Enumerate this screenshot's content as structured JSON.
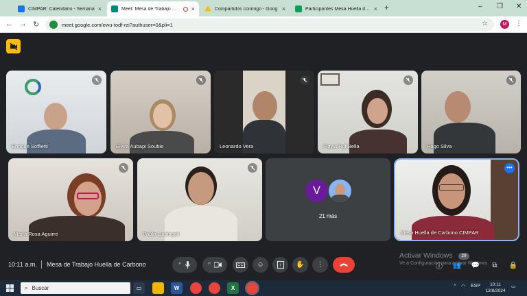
{
  "browser": {
    "tabs": [
      {
        "title": "CIMPAR: Calendario - Semana",
        "close": "×",
        "favicon_color": "#1a73e8",
        "active": false
      },
      {
        "title": "Meet: Mesa de Trabajo Hue",
        "close": "×",
        "favicon_color": "#00897b",
        "active": true
      },
      {
        "title": "Compartidos conmigo - Goog",
        "close": "×",
        "favicon_color": "#fbbc04",
        "active": false
      },
      {
        "title": "Participantes Mesa Huella de C",
        "close": "×",
        "favicon_color": "#0f9d58",
        "active": false
      }
    ],
    "new_tab": "+",
    "window_controls": {
      "minimize": "–",
      "restore": "❐",
      "close": "✕"
    },
    "url": "meet.google.com/ewu-todf-rzi?authuser=0&pli=1",
    "profile_initial": "M"
  },
  "meet": {
    "participants": [
      {
        "name": "Enrique Soffietti"
      },
      {
        "name": "Elvira Aubapi Soubie"
      },
      {
        "name": "Leonardo Vera"
      },
      {
        "name": "Flavia Rut Bella"
      },
      {
        "name": "Hugo Silva"
      },
      {
        "name": "María Rosa Aguirre"
      },
      {
        "name": "Pablo Lucángeli"
      },
      {
        "name": "Mesa Huella de Carbono CIMPAR"
      }
    ],
    "more": {
      "avatar_letter": "V",
      "label": "21 más"
    },
    "bottom": {
      "time": "10:11 a.m.",
      "meeting_title": "Mesa de Trabajo Huella de Carbono",
      "participants_count": "29"
    },
    "watermark": {
      "line1": "Activar Windows",
      "line2": "Ve a Configuración para activar Windows."
    }
  },
  "taskbar": {
    "search_placeholder": "Buscar",
    "language": "ESP",
    "time": "10:11",
    "date": "13/8/2024"
  },
  "colors": {
    "accent": "#1a73e8",
    "hangup": "#ea4335",
    "camera_off": "#fbbc04"
  }
}
